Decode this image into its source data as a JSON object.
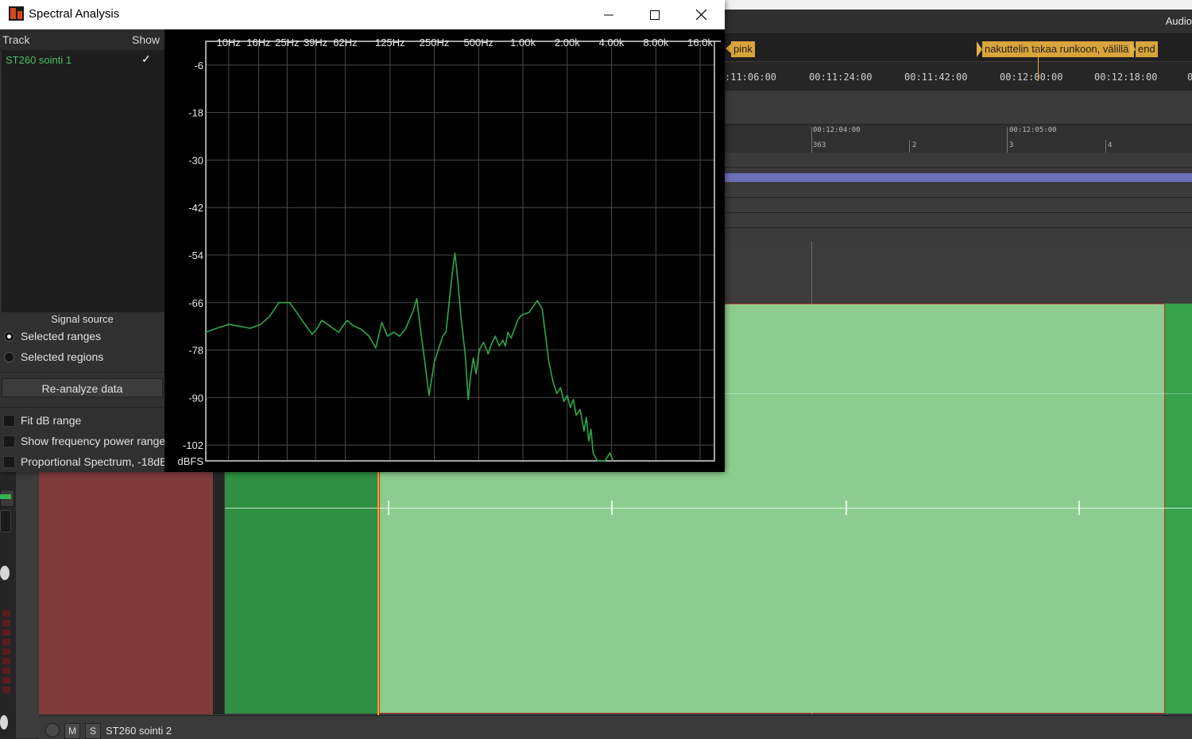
{
  "window": {
    "title": "Spectral Analysis",
    "controls": {
      "minimize": "—",
      "maximize": "☐",
      "close": "✕"
    }
  },
  "track_list": {
    "header_track": "Track",
    "header_show": "Show",
    "rows": [
      {
        "name": "ST260 sointi 1",
        "shown": "✓"
      }
    ]
  },
  "signal_source": {
    "title": "Signal source",
    "options": [
      {
        "label": "Selected ranges",
        "selected": true
      },
      {
        "label": "Selected regions",
        "selected": false
      }
    ]
  },
  "reanalyze_label": "Re-analyze data",
  "options": [
    {
      "label": "Fit dB range",
      "checked": false
    },
    {
      "label": "Show frequency power range",
      "checked": false
    },
    {
      "label": "Proportional Spectrum, -18dB",
      "checked": false
    }
  ],
  "chart_data": {
    "type": "line",
    "x_scale": "log",
    "x_tick_labels": [
      "10Hz",
      "16Hz",
      "25Hz",
      "39Hz",
      "62Hz",
      "125Hz",
      "250Hz",
      "500Hz",
      "1.00k",
      "2.00k",
      "4.00k",
      "8.00k",
      "16.0k"
    ],
    "x_ticks_hz": [
      10,
      16,
      25,
      39,
      62,
      125,
      250,
      500,
      1000,
      2000,
      4000,
      8000,
      16000
    ],
    "xlim": [
      7,
      20000
    ],
    "y_tick_labels": [
      "-6",
      "-18",
      "-30",
      "-42",
      "-54",
      "-66",
      "-78",
      "-90",
      "-102"
    ],
    "y_ticks": [
      -6,
      -18,
      -30,
      -42,
      -54,
      -66,
      -78,
      -90,
      -102
    ],
    "ylabel": "dBFS",
    "ylim": [
      -106,
      0
    ],
    "grid": true,
    "series": [
      {
        "color": "#2fa84a",
        "points": [
          [
            7,
            -73.5
          ],
          [
            8.3,
            -72.5
          ],
          [
            10,
            -71.5
          ],
          [
            12,
            -72
          ],
          [
            14,
            -72.5
          ],
          [
            16.5,
            -71.5
          ],
          [
            19,
            -69.5
          ],
          [
            22,
            -66
          ],
          [
            26,
            -66
          ],
          [
            29,
            -68.5
          ],
          [
            33,
            -71.5
          ],
          [
            37,
            -74
          ],
          [
            40,
            -72.5
          ],
          [
            43,
            -70.5
          ],
          [
            47,
            -71.5
          ],
          [
            51,
            -72.5
          ],
          [
            56,
            -73.5
          ],
          [
            60,
            -71.8
          ],
          [
            64,
            -70.5
          ],
          [
            70,
            -71.8
          ],
          [
            80,
            -72.8
          ],
          [
            90,
            -74.5
          ],
          [
            100,
            -77.5
          ],
          [
            110,
            -71
          ],
          [
            120,
            -74.5
          ],
          [
            132,
            -73.5
          ],
          [
            145,
            -74.5
          ],
          [
            160,
            -72.5
          ],
          [
            180,
            -68
          ],
          [
            190,
            -65
          ],
          [
            200,
            -72
          ],
          [
            212,
            -79
          ],
          [
            230,
            -89.5
          ],
          [
            250,
            -81
          ],
          [
            285,
            -74.5
          ],
          [
            300,
            -73.5
          ],
          [
            315,
            -66
          ],
          [
            330,
            -59
          ],
          [
            345,
            -53.5
          ],
          [
            360,
            -60
          ],
          [
            380,
            -70
          ],
          [
            405,
            -79
          ],
          [
            425,
            -90.5
          ],
          [
            440,
            -85
          ],
          [
            460,
            -80
          ],
          [
            480,
            -84
          ],
          [
            505,
            -78
          ],
          [
            540,
            -76
          ],
          [
            580,
            -79
          ],
          [
            610,
            -76.5
          ],
          [
            650,
            -74.5
          ],
          [
            690,
            -77
          ],
          [
            730,
            -75.5
          ],
          [
            760,
            -77
          ],
          [
            790,
            -73.5
          ],
          [
            830,
            -75
          ],
          [
            880,
            -72.5
          ],
          [
            920,
            -70.5
          ],
          [
            960,
            -69.5
          ],
          [
            1000,
            -69
          ],
          [
            1100,
            -68.5
          ],
          [
            1250,
            -65.5
          ],
          [
            1350,
            -67.5
          ],
          [
            1500,
            -81
          ],
          [
            1600,
            -86
          ],
          [
            1700,
            -89
          ],
          [
            1800,
            -87.5
          ],
          [
            1900,
            -91
          ],
          [
            2000,
            -89.5
          ],
          [
            2100,
            -92.5
          ],
          [
            2200,
            -90.5
          ],
          [
            2300,
            -94.5
          ],
          [
            2450,
            -93
          ],
          [
            2600,
            -98.5
          ],
          [
            2700,
            -95
          ],
          [
            2800,
            -101
          ],
          [
            2900,
            -98
          ],
          [
            3000,
            -104
          ],
          [
            3200,
            -106
          ],
          [
            3400,
            -106
          ],
          [
            3600,
            -106
          ],
          [
            3900,
            -104
          ],
          [
            4100,
            -106
          ]
        ]
      }
    ]
  },
  "daw": {
    "audio_label": "Audio",
    "markers": [
      {
        "label": "pink"
      },
      {
        "label": "nakuttelin takaa runkoon, välillä"
      },
      {
        "label": "end"
      }
    ],
    "timecodes": [
      ":11:06:00",
      "00:11:24:00",
      "00:11:42:00",
      "00:12:00:00",
      "00:12:18:00",
      "0"
    ],
    "bbt_top": [
      "00:12:04:00",
      "00:12:05:00"
    ],
    "bbt_bottom": [
      "363",
      "2",
      "3",
      "4"
    ],
    "track2": {
      "m": "M",
      "s": "S",
      "name": "ST260 sointi 2"
    }
  }
}
